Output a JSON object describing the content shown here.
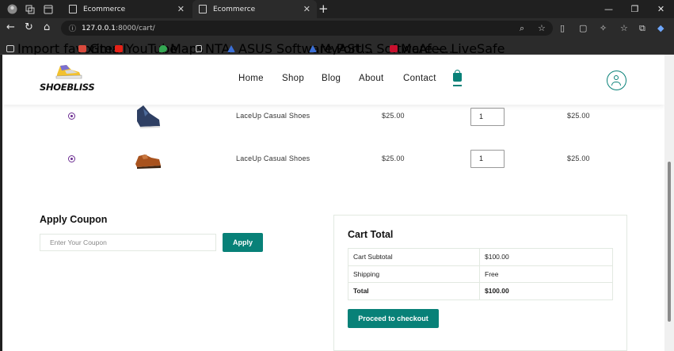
{
  "browser": {
    "tabs": [
      {
        "title": "Ecommerce"
      },
      {
        "title": "Ecommerce"
      }
    ],
    "url": {
      "host": "127.0.0.1",
      "rest": ":8000/cart/"
    },
    "bookmarks": [
      "Import favorites",
      "Gmail",
      "YouTube",
      "Maps",
      "NTA",
      "ASUS Software Port...",
      "MyASUS Software -...",
      "McAfee LiveSafe"
    ]
  },
  "header": {
    "logo_text": "SHOEBLISS",
    "menu": [
      "Home",
      "Shop",
      "Blog",
      "About",
      "Contact"
    ]
  },
  "cart": {
    "rows": [
      {
        "product": "LaceUp Casual Shoes",
        "price": "$25.00",
        "quantity": "1",
        "subtotal": "$25.00",
        "shoe_color": "#2e3f63"
      },
      {
        "product": "LaceUp Casual Shoes",
        "price": "$25.00",
        "quantity": "1",
        "subtotal": "$25.00",
        "shoe_color": "#a8521d"
      }
    ]
  },
  "coupon": {
    "heading": "Apply Coupon",
    "placeholder": "Enter Your Coupon",
    "button": "Apply"
  },
  "totals": {
    "heading": "Cart Total",
    "rows": [
      {
        "label": "Cart Subtotal",
        "value": "$100.00"
      },
      {
        "label": "Shipping",
        "value": "Free"
      },
      {
        "label": "Total",
        "value": "$100.00"
      }
    ],
    "checkout_button": "Proceed to checkout"
  },
  "colors": {
    "accent": "#088178",
    "remove": "#6b2c91"
  }
}
